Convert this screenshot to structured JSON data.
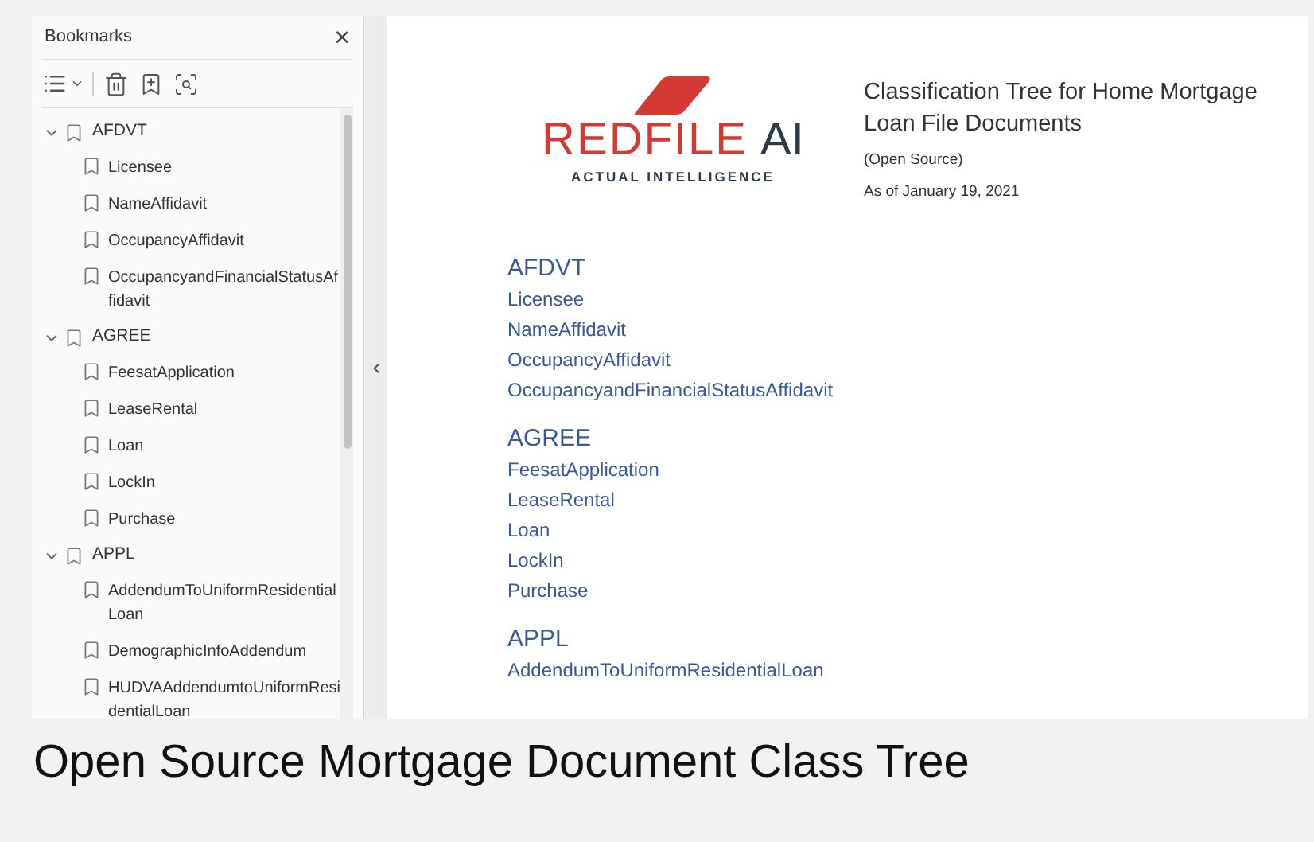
{
  "sidebar": {
    "title": "Bookmarks",
    "close": "×",
    "tree": [
      {
        "label": "AFDVT",
        "expanded": true,
        "children": [
          {
            "label": "Licensee"
          },
          {
            "label": "NameAffidavit"
          },
          {
            "label": "OccupancyAffidavit"
          },
          {
            "label": "OccupancyandFinancialStatusAffidavit"
          }
        ]
      },
      {
        "label": "AGREE",
        "expanded": true,
        "children": [
          {
            "label": "FeesatApplication"
          },
          {
            "label": "LeaseRental"
          },
          {
            "label": "Loan"
          },
          {
            "label": "LockIn"
          },
          {
            "label": "Purchase"
          }
        ]
      },
      {
        "label": "APPL",
        "expanded": true,
        "children": [
          {
            "label": "AddendumToUniformResidentialLoan"
          },
          {
            "label": "DemographicInfoAddendum"
          },
          {
            "label": "HUDVAAddendumtoUniformResidentialLoan"
          }
        ]
      }
    ]
  },
  "document": {
    "logo": {
      "name": "REDFILE",
      "suffix": "AI",
      "tagline": "ACTUAL INTELLIGENCE"
    },
    "title": "Classification Tree for Home Mortgage Loan File Documents",
    "subtitle": "(Open Source)",
    "date": "As of January 19, 2021",
    "sections": [
      {
        "heading": "AFDVT",
        "items": [
          "Licensee",
          "NameAffidavit",
          "OccupancyAffidavit",
          "OccupancyandFinancialStatusAffidavit"
        ]
      },
      {
        "heading": "AGREE",
        "items": [
          "FeesatApplication",
          "LeaseRental",
          "Loan",
          "LockIn",
          "Purchase"
        ]
      },
      {
        "heading": "APPL",
        "items": [
          "AddendumToUniformResidentialLoan"
        ]
      }
    ]
  },
  "caption": "Open Source Mortgage Document Class Tree"
}
